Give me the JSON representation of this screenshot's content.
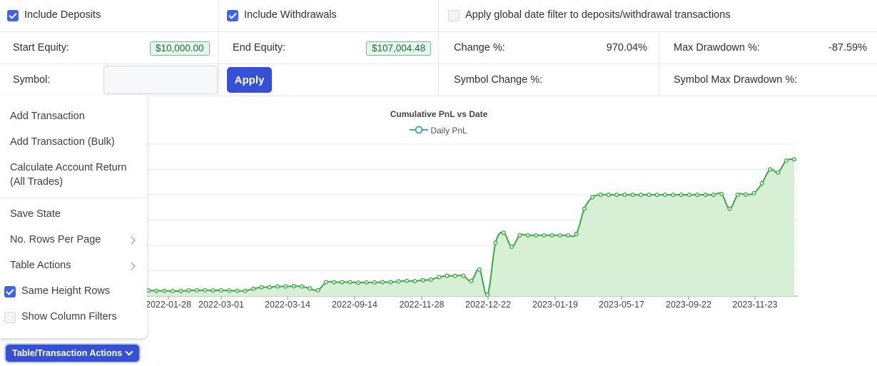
{
  "filters": {
    "include_deposits": {
      "label": "Include Deposits",
      "checked": true
    },
    "include_withdrawals": {
      "label": "Include Withdrawals",
      "checked": true
    },
    "global_date_filter": {
      "label": "Apply global date filter to deposits/withdrawal transactions",
      "checked": false
    }
  },
  "stats": {
    "start_equity_label": "Start Equity:",
    "start_equity_value": "$10,000.00",
    "end_equity_label": "End Equity:",
    "end_equity_value": "$107,004.48",
    "change_label": "Change %:",
    "change_value": "970.04%",
    "max_drawdown_label": "Max Drawdown %:",
    "max_drawdown_value": "-87.59%",
    "symbol_label": "Symbol:",
    "symbol_value": "",
    "apply_label": "Apply",
    "symbol_change_label": "Symbol Change %:",
    "symbol_max_drawdown_label": "Symbol Max Drawdown %:"
  },
  "menu": {
    "add_transaction": "Add Transaction",
    "add_transaction_bulk": "Add Transaction (Bulk)",
    "calc_return_line1": "Calculate Account Return",
    "calc_return_line2": "(All Trades)",
    "save_state": "Save State",
    "rows_per_page": "No. Rows Per Page",
    "table_actions": "Table Actions",
    "same_height_rows": {
      "label": "Same Height Rows",
      "checked": true
    },
    "show_column_filters": {
      "label": "Show Column Filters",
      "checked": false
    },
    "dropdown_label": "Table/Transaction Actions"
  },
  "colors": {
    "accent": "#3550d4",
    "line": "#3cab45",
    "fill": "#d6efd5",
    "legend_line": "#4a9fe0",
    "badge_bg": "#e6f6ec"
  },
  "chart_data": {
    "type": "area",
    "title": "Cumulative PnL vs Date",
    "legend": [
      {
        "name": "Daily PnL",
        "position": "top-center"
      }
    ],
    "x_ticks": [
      "2022-01-28",
      "2022-03-01",
      "2022-03-14",
      "2022-09-14",
      "2022-11-28",
      "2022-12-22",
      "2023-01-19",
      "2023-05-17",
      "2023-09-22",
      "2023-11-23"
    ],
    "ylim": [
      0,
      6
    ],
    "grid": true,
    "series": [
      {
        "name": "Daily PnL",
        "values": [
          0.22,
          0.21,
          0.21,
          0.2,
          0.2,
          0.22,
          0.23,
          0.23,
          0.22,
          0.23,
          0.22,
          0.21,
          0.21,
          0.29,
          0.35,
          0.35,
          0.38,
          0.38,
          0.39,
          0.38,
          0.3,
          0.23,
          0.55,
          0.55,
          0.55,
          0.55,
          0.53,
          0.54,
          0.54,
          0.55,
          0.55,
          0.58,
          0.6,
          0.59,
          0.63,
          0.65,
          0.75,
          0.8,
          0.8,
          0.8,
          0.6,
          1.05,
          0.05,
          2.1,
          2.5,
          1.95,
          2.4,
          2.4,
          2.4,
          2.4,
          2.4,
          2.4,
          2.4,
          2.45,
          3.45,
          3.9,
          4.0,
          4.0,
          4.0,
          4.0,
          4.0,
          4.0,
          4.0,
          4.0,
          4.0,
          4.0,
          4.0,
          4.0,
          4.0,
          4.0,
          4.0,
          4.03,
          3.45,
          4.0,
          4.01,
          4.06,
          4.45,
          5.0,
          4.88,
          5.35,
          5.4
        ]
      }
    ]
  }
}
